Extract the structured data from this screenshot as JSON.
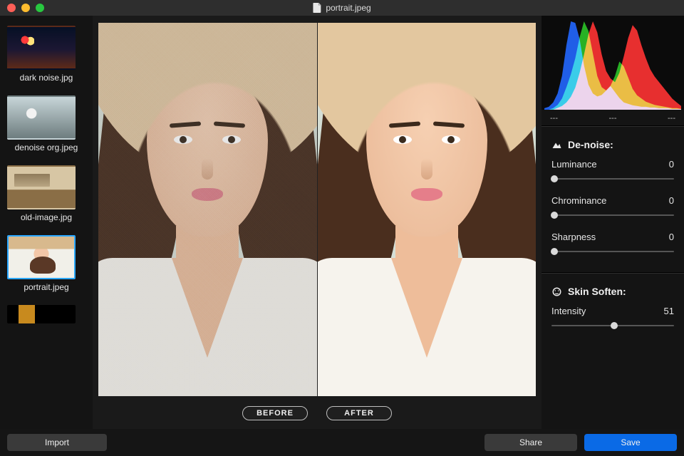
{
  "window": {
    "title": "portrait.jpeg"
  },
  "sidebar": {
    "thumbs": [
      {
        "label": "dark noise.jpg",
        "selected": false,
        "kind": "night"
      },
      {
        "label": "denoise org.jpeg",
        "selected": false,
        "kind": "bird"
      },
      {
        "label": "old-image.jpg",
        "selected": false,
        "kind": "old"
      },
      {
        "label": "portrait.jpeg",
        "selected": true,
        "kind": "portrait"
      }
    ],
    "partial_last": true
  },
  "compare": {
    "before_label": "BEFORE",
    "after_label": "AFTER"
  },
  "histogram": {
    "tick_left": "---",
    "tick_center": "---",
    "tick_right": "---",
    "series": {
      "blue": [
        2,
        4,
        10,
        22,
        46,
        88,
        120,
        118,
        96,
        60,
        34,
        22,
        18,
        20,
        26,
        32,
        24,
        16,
        10,
        8,
        6,
        5,
        4,
        4,
        3,
        3,
        2,
        2,
        2,
        1,
        1,
        1
      ],
      "green": [
        0,
        0,
        2,
        6,
        14,
        28,
        44,
        64,
        90,
        110,
        98,
        70,
        42,
        28,
        24,
        30,
        42,
        60,
        54,
        40,
        26,
        18,
        14,
        10,
        8,
        6,
        5,
        4,
        3,
        2,
        2,
        1
      ],
      "red": [
        0,
        0,
        0,
        2,
        4,
        8,
        14,
        24,
        40,
        60,
        82,
        96,
        84,
        60,
        42,
        34,
        30,
        40,
        58,
        78,
        92,
        86,
        70,
        56,
        44,
        36,
        30,
        24,
        18,
        12,
        8,
        4
      ]
    }
  },
  "denoise": {
    "heading": "De-noise:",
    "params": [
      {
        "key": "luminance",
        "label": "Luminance",
        "value": 0
      },
      {
        "key": "chrominance",
        "label": "Chrominance",
        "value": 0
      },
      {
        "key": "sharpness",
        "label": "Sharpness",
        "value": 0
      }
    ]
  },
  "skin": {
    "heading": "Skin Soften:",
    "params": [
      {
        "key": "intensity",
        "label": "Intensity",
        "value": 51
      }
    ]
  },
  "buttons": {
    "import": "Import",
    "share": "Share",
    "save": "Save"
  },
  "slider_max": 100
}
